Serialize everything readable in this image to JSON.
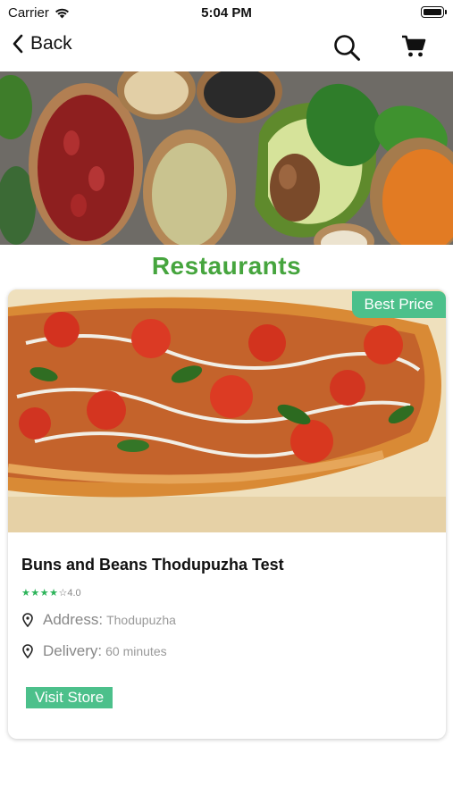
{
  "status_bar": {
    "carrier": "Carrier",
    "time": "5:04 PM"
  },
  "nav": {
    "back_label": "Back",
    "icons": [
      "chevron-left-icon",
      "search-icon",
      "cart-icon"
    ]
  },
  "section": {
    "title": "Restaurants"
  },
  "restaurant": {
    "badge": "Best Price",
    "name": "Buns and Beans Thodupuzha Test",
    "stars_filled": "★★★★",
    "stars_empty": "☆",
    "rating": "4.0",
    "address_label": "Address:",
    "address_value": "Thodupuzha",
    "delivery_label": "Delivery:",
    "delivery_value": "60 minutes",
    "visit_label": "Visit Store"
  },
  "colors": {
    "title_green": "#46a53e",
    "accent": "#4cc08b",
    "star": "#2db45a"
  }
}
